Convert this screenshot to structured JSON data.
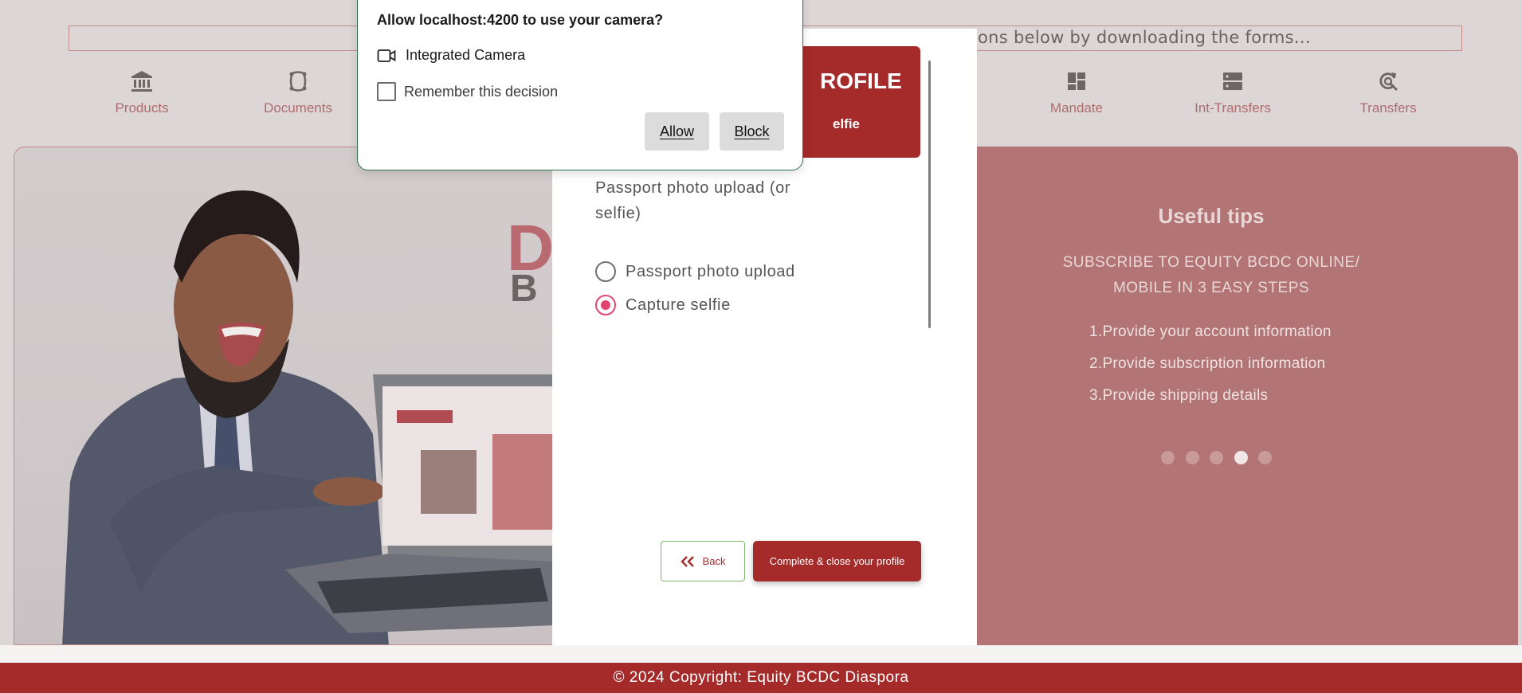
{
  "marquee": {
    "text": "ons below by downloading the forms..."
  },
  "nav": {
    "items": [
      {
        "label": "Products",
        "icon": "bank-icon"
      },
      {
        "label": "Documents",
        "icon": "documents-icon"
      },
      {
        "label": "Mandate",
        "icon": "dashboard-icon"
      },
      {
        "label": "Int-Transfers",
        "icon": "server-icon"
      },
      {
        "label": "Transfers",
        "icon": "refresh-search-icon"
      }
    ]
  },
  "hero": {
    "big_letter_1": "D",
    "big_letter_2": "B",
    "laptop_brand": "DIASPORA BANKING"
  },
  "card": {
    "header_title": "ROFILE",
    "header_subtitle": "elfie",
    "question": "Passport photo upload (or selfie)",
    "options": [
      {
        "label": "Passport photo upload",
        "checked": false
      },
      {
        "label": "Capture selfie",
        "checked": true
      }
    ],
    "back_label": "Back",
    "complete_label": "Complete & close your profile"
  },
  "tips": {
    "title": "Useful tips",
    "subtitle": "SUBSCRIBE TO EQUITY BCDC ONLINE/ MOBILE IN 3 EASY STEPS",
    "steps": [
      "1.Provide your account information",
      "2.Provide subscription information",
      "3.Provide shipping details"
    ],
    "dots": 5,
    "active_dot": 3
  },
  "permission": {
    "title": "Allow localhost:4200 to use your camera?",
    "device": "Integrated Camera",
    "remember_label": "Remember this decision",
    "allow_label": "Allow",
    "block_label": "Block"
  },
  "footer": {
    "text": "© 2024 Copyright: Equity BCDC Diaspora"
  },
  "colors": {
    "brand_red": "#a52a2a",
    "tips_bg": "#b27474",
    "radio_accent": "#e04570"
  }
}
